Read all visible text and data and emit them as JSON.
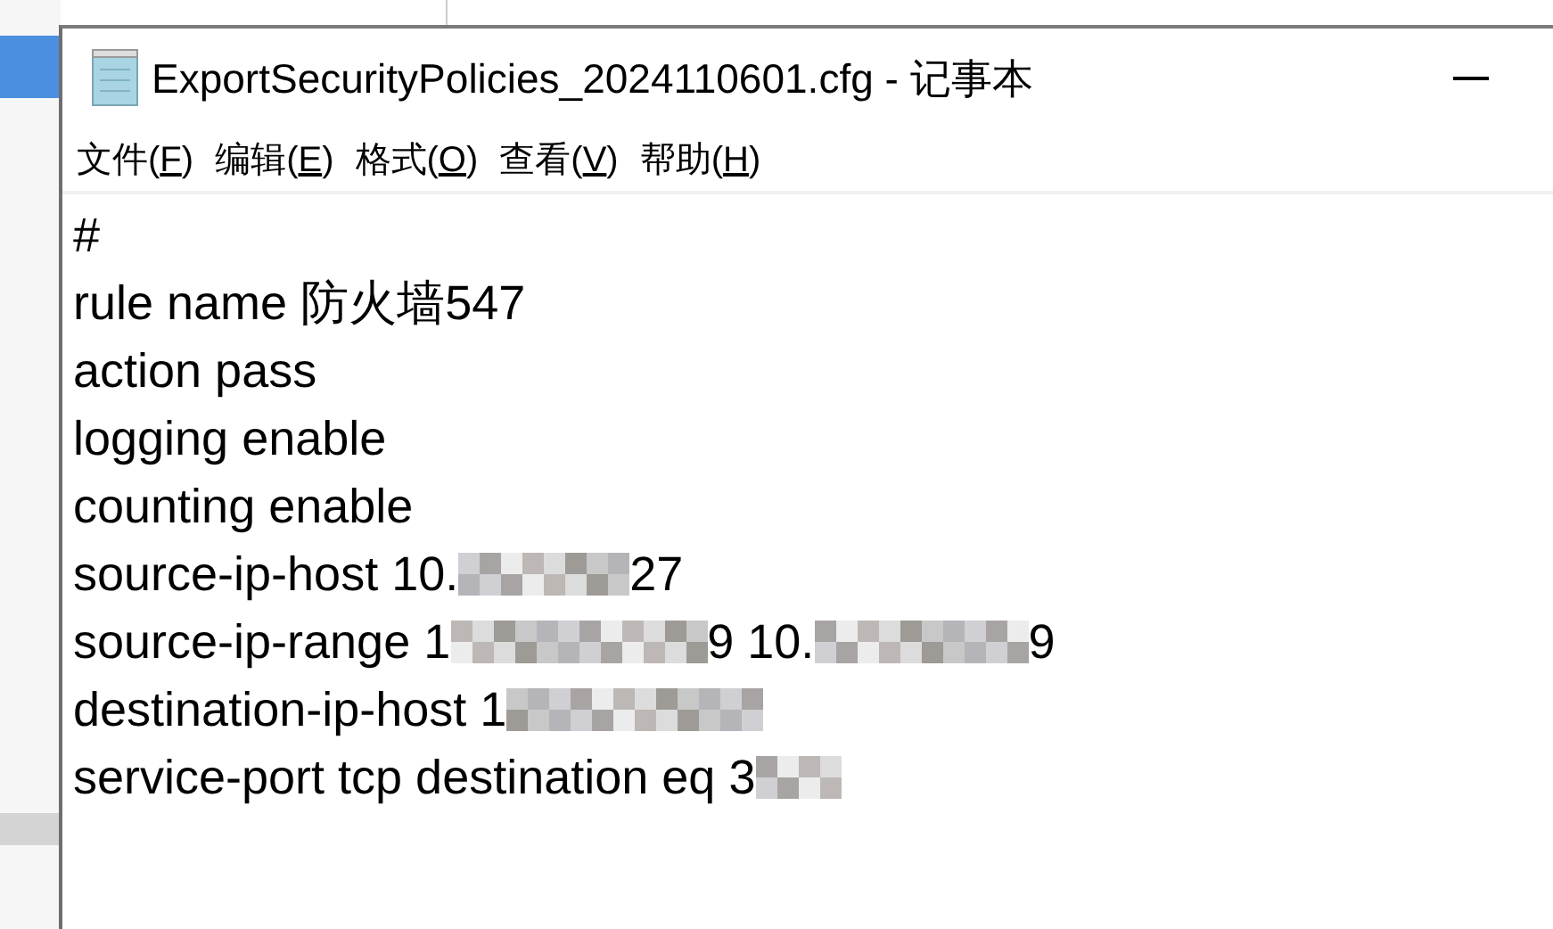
{
  "window": {
    "title": "ExportSecurityPolicies_2024110601.cfg - 记事本"
  },
  "menu": [
    {
      "label": "文件(",
      "key": "F",
      "tail": ")"
    },
    {
      "label": "编辑(",
      "key": "E",
      "tail": ")"
    },
    {
      "label": "格式(",
      "key": "O",
      "tail": ")"
    },
    {
      "label": "查看(",
      "key": "V",
      "tail": ")"
    },
    {
      "label": "帮助(",
      "key": "H",
      "tail": ")"
    }
  ],
  "lines": [
    [
      {
        "kind": "text",
        "text": "#"
      }
    ],
    [
      {
        "kind": "text",
        "text": "rule name 防火墙547"
      }
    ],
    [
      {
        "kind": "text",
        "text": "action pass"
      }
    ],
    [
      {
        "kind": "text",
        "text": "logging enable"
      }
    ],
    [
      {
        "kind": "text",
        "text": "counting enable"
      }
    ],
    [
      {
        "kind": "text",
        "text": "source-ip-host 10."
      },
      {
        "kind": "redacted"
      },
      {
        "kind": "text",
        "text": "27"
      }
    ],
    [
      {
        "kind": "text",
        "text": "source-ip-range 1"
      },
      {
        "kind": "redacted"
      },
      {
        "kind": "text",
        "text": "9 10."
      },
      {
        "kind": "redacted"
      },
      {
        "kind": "text",
        "text": "9"
      }
    ],
    [
      {
        "kind": "text",
        "text": "destination-ip-host 1"
      },
      {
        "kind": "redacted"
      }
    ],
    [
      {
        "kind": "text",
        "text": "service-port tcp destination eq 3"
      },
      {
        "kind": "redacted"
      }
    ]
  ]
}
